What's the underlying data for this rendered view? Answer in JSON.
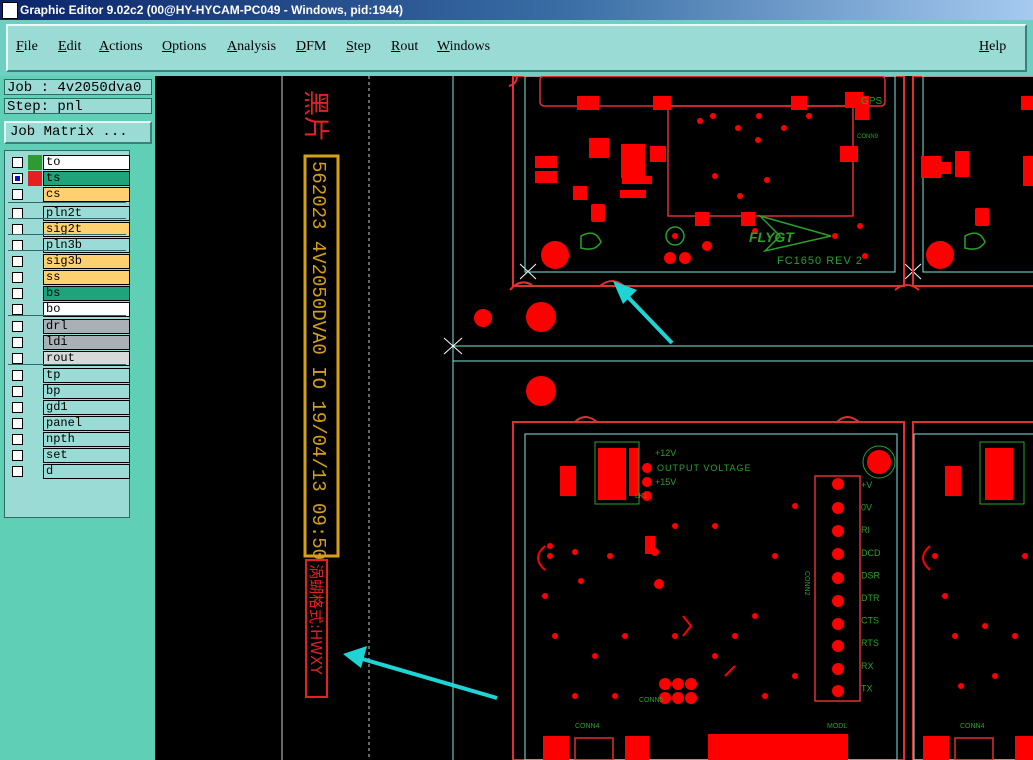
{
  "window": {
    "title": "Graphic Editor 9.02c2 (00@HY-HYCAM-PC049 - Windows, pid:1944)"
  },
  "menu": {
    "items": [
      "File",
      "Edit",
      "Actions",
      "Options",
      "Analysis",
      "DFM",
      "Step",
      "Rout",
      "Windows"
    ],
    "help": "Help"
  },
  "job": {
    "label": "Job : 4v2050dva0",
    "step": "Step: pnl",
    "matrix_button": "Job Matrix ..."
  },
  "layers": [
    {
      "name": "to",
      "color": "#ffffff",
      "swatch": "#2f9a2f",
      "checked": false
    },
    {
      "name": "ts",
      "color": "#1fa37a",
      "swatch": "#e52020",
      "checked": true
    },
    {
      "name": "cs",
      "color": "#ffd070",
      "swatch": "#9bdbd6",
      "checked": false
    },
    {
      "name": "pln2t",
      "color": "#9bdbd6",
      "swatch": "#9bdbd6",
      "checked": false
    },
    {
      "name": "sig2t",
      "color": "#ffd070",
      "swatch": "#9bdbd6",
      "checked": false
    },
    {
      "name": "pln3b",
      "color": "#9bdbd6",
      "swatch": "#9bdbd6",
      "checked": false
    },
    {
      "name": "sig3b",
      "color": "#ffd070",
      "swatch": "#9bdbd6",
      "checked": false
    },
    {
      "name": "ss",
      "color": "#ffd070",
      "swatch": "#9bdbd6",
      "checked": false
    },
    {
      "name": "bs",
      "color": "#1fa37a",
      "swatch": "#9bdbd6",
      "checked": false
    },
    {
      "name": "bo",
      "color": "#ffffff",
      "swatch": "#9bdbd6",
      "checked": false
    },
    {
      "name": "drl",
      "color": "#aab0b6",
      "swatch": "#9bdbd6",
      "checked": false
    },
    {
      "name": "ldi",
      "color": "#aab0b6",
      "swatch": "#9bdbd6",
      "checked": false
    },
    {
      "name": "rout",
      "color": "#d8d8d8",
      "swatch": "#9bdbd6",
      "checked": false
    },
    {
      "name": "tp",
      "color": "#9bdbd6",
      "swatch": "#9bdbd6",
      "checked": false
    },
    {
      "name": "bp",
      "color": "#9bdbd6",
      "swatch": "#9bdbd6",
      "checked": false
    },
    {
      "name": "gd1",
      "color": "#9bdbd6",
      "swatch": "#9bdbd6",
      "checked": false
    },
    {
      "name": "panel",
      "color": "#9bdbd6",
      "swatch": "#9bdbd6",
      "checked": false
    },
    {
      "name": "npth",
      "color": "#9bdbd6",
      "swatch": "#9bdbd6",
      "checked": false
    },
    {
      "name": "set",
      "color": "#9bdbd6",
      "swatch": "#9bdbd6",
      "checked": false
    },
    {
      "name": "d",
      "color": "#9bdbd6",
      "swatch": "#9bdbd6",
      "checked": false
    }
  ],
  "canvas": {
    "vertical_text_top": "黑片",
    "vertical_text_main": "562023 4V2050DVA0 IO 19/04/13 09:50",
    "vertical_text_bottom": "涡蝴格式:HWXY",
    "board_text": {
      "flygt": "FLYGT",
      "fc": "FC1650 REV 2",
      "gps": "GPS",
      "conn9": "CONN9",
      "plus12": "+12V",
      "plus15": "+15V",
      "output_voltage": "OUTPUT VOLTAGE",
      "conn2": "CONN2",
      "conn5": "CONN5",
      "conn4": "CONN4",
      "modl": "MODL",
      "lk1": "LK1",
      "conn_pins": [
        "+V",
        "0V",
        "RI",
        "DCD",
        "DSR",
        "DTR",
        "CTS",
        "RTS",
        "RX",
        "TX"
      ]
    }
  },
  "colors": {
    "pad": "#ff0000",
    "outline": "#e03030",
    "silk": "#2aa02a",
    "gold": "#d4a018",
    "arrow": "#1fd4d4",
    "profile": "#7fe6e0"
  }
}
